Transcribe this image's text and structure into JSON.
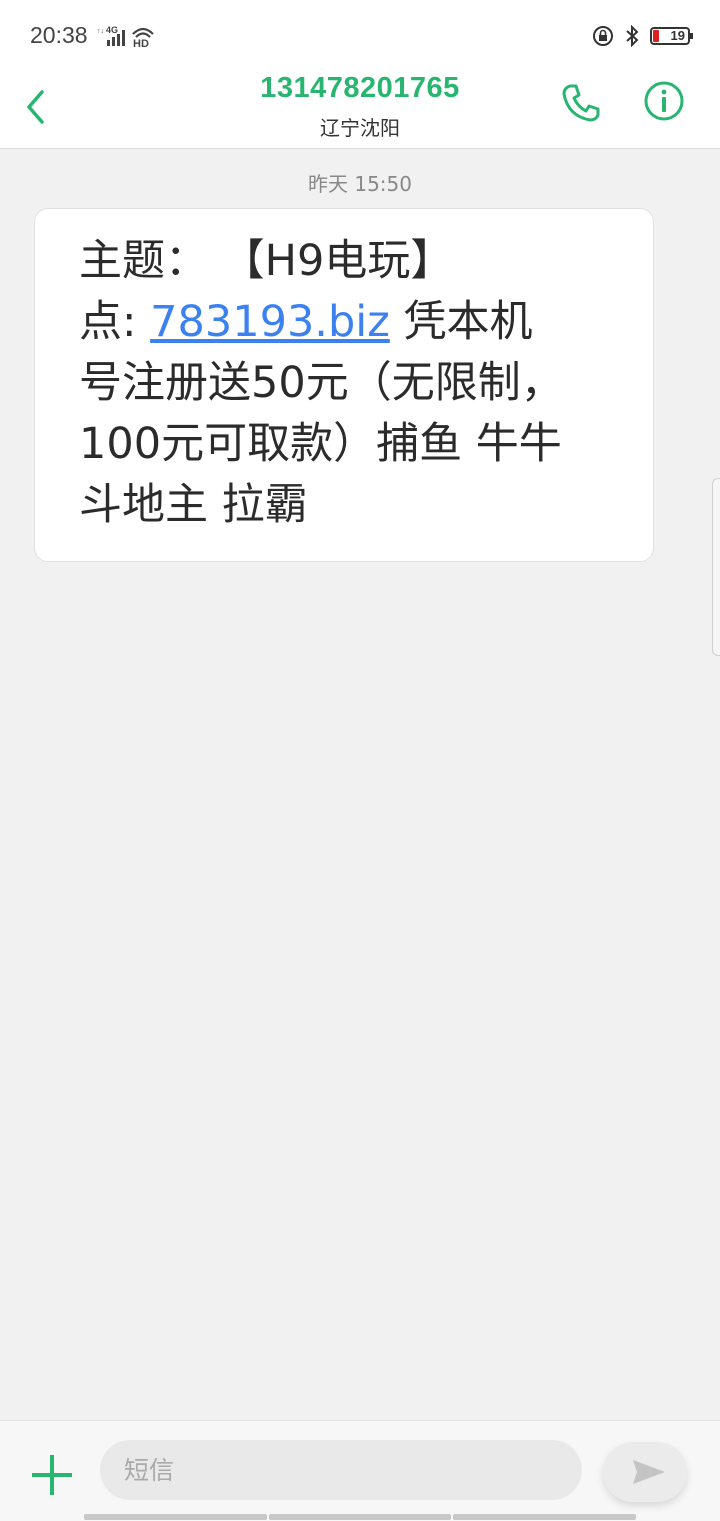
{
  "status_bar": {
    "time": "20:38",
    "network_label": "4G",
    "hd_label": "HD",
    "battery_level": "19",
    "icons": [
      "lock-rotation-icon",
      "bluetooth-icon",
      "battery-icon"
    ]
  },
  "header": {
    "phone_number": "131478201765",
    "location": "辽宁沈阳",
    "icons": [
      "back-icon",
      "phone-icon",
      "info-icon"
    ],
    "accent_color": "#27b56f"
  },
  "conversation": {
    "timestamp": "昨天 15:50",
    "message": {
      "line1": "主题：  【H9电玩】",
      "line2_prefix": "点: ",
      "link_text": "783193.biz",
      "line2_suffix": " 凭本机",
      "line3": "号注册送50元（无限制，",
      "line4": "100元可取款）捕鱼 牛牛",
      "line5": "斗地主 拉霸",
      "link_color": "#3b82f0"
    }
  },
  "compose": {
    "placeholder": "短信",
    "value": "",
    "icons": [
      "add-icon",
      "send-icon"
    ]
  }
}
